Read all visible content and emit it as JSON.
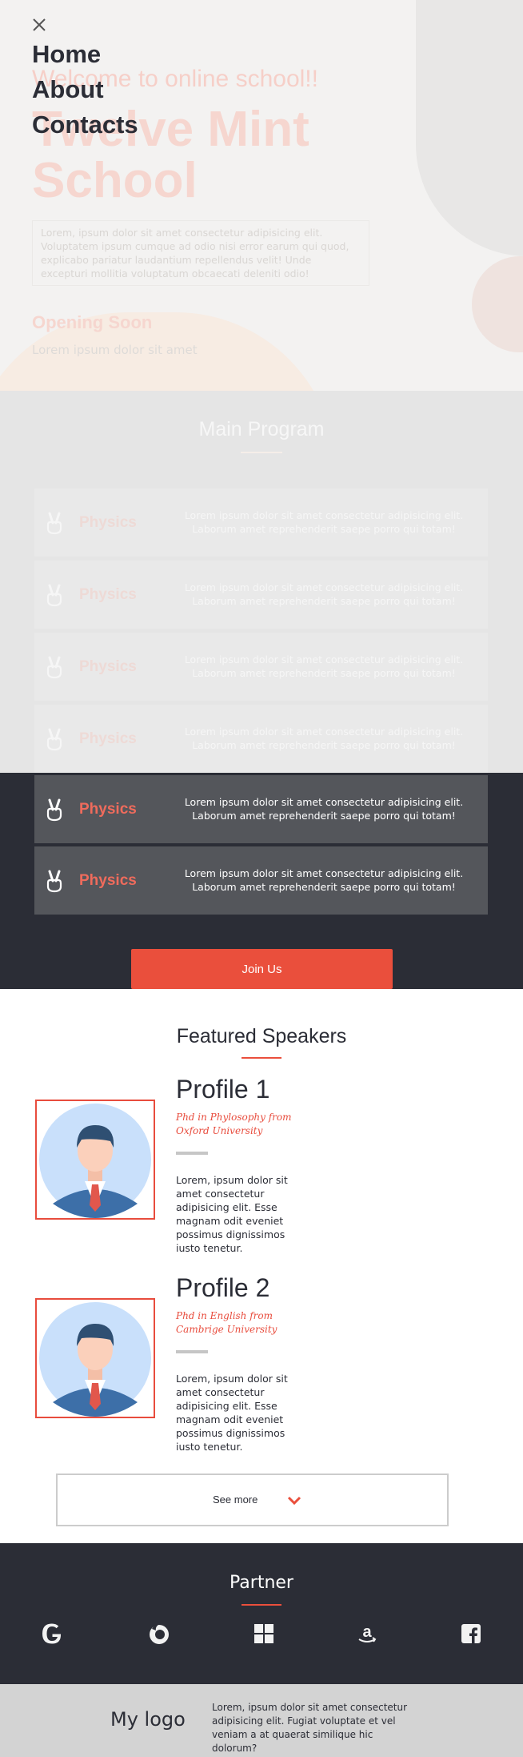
{
  "menu": {
    "items": [
      {
        "label": "Home"
      },
      {
        "label": "About"
      },
      {
        "label": "Contacts"
      }
    ]
  },
  "hero": {
    "welcome": "Welcome to online school!!",
    "title_line1": "Twelve Mint",
    "title_line2": "School",
    "paragraph": "Lorem, ipsum dolor sit amet consectetur adipisicing elit. Voluptatem ipsum cumque ad odio nisi error earum qui quod, explicabo pariatur laudantium repellendus velit! Unde excepturi mollitia voluptatum obcaecati deleniti odio!",
    "opening": "Opening Soon",
    "opening_sub": "Lorem ipsum dolor sit amet"
  },
  "program": {
    "title": "Main Program",
    "cards": [
      {
        "name": "Physics",
        "desc": "Lorem ipsum dolor sit amet consectetur adipisicing elit. Laborum amet reprehenderit saepe porro qui totam!"
      },
      {
        "name": "Physics",
        "desc": "Lorem ipsum dolor sit amet consectetur adipisicing elit. Laborum amet reprehenderit saepe porro qui totam!"
      },
      {
        "name": "Physics",
        "desc": "Lorem ipsum dolor sit amet consectetur adipisicing elit. Laborum amet reprehenderit saepe porro qui totam!"
      },
      {
        "name": "Physics",
        "desc": "Lorem ipsum dolor sit amet consectetur adipisicing elit. Laborum amet reprehenderit saepe porro qui totam!"
      },
      {
        "name": "Physics",
        "desc": "Lorem ipsum dolor sit amet consectetur adipisicing elit. Laborum amet reprehenderit saepe porro qui totam!"
      },
      {
        "name": "Physics",
        "desc": "Lorem ipsum dolor sit amet consectetur adipisicing elit. Laborum amet reprehenderit saepe porro qui totam!"
      }
    ],
    "icon": "peace-hand-icon",
    "join_label": "Join Us"
  },
  "speakers": {
    "title": "Featured Speakers",
    "profiles": [
      {
        "name": "Profile 1",
        "degree": "Phd in Phylosophy from Oxford University",
        "bio": "Lorem, ipsum dolor sit amet consectetur adipisicing elit. Esse magnam odit eveniet possimus dignissimos iusto tenetur."
      },
      {
        "name": "Profile 2",
        "degree": "Phd in English from Cambrige University",
        "bio": "Lorem, ipsum dolor sit amet consectetur adipisicing elit. Esse magnam odit eveniet possimus dignissimos iusto tenetur."
      }
    ],
    "see_more": "See more"
  },
  "partner": {
    "title": "Partner",
    "logos": [
      "google-icon",
      "firefox-icon",
      "windows-icon",
      "amazon-icon",
      "facebook-icon"
    ]
  },
  "footer": {
    "logo": "My logo",
    "text": "Lorem, ipsum dolor sit amet consectetur adipisicing elit. Fugiat voluptate et vel veniam a at quaerat similique hic dolorum?"
  },
  "colors": {
    "accent": "#ea4f3c",
    "dark": "#2b2d36",
    "card": "#54565b"
  }
}
